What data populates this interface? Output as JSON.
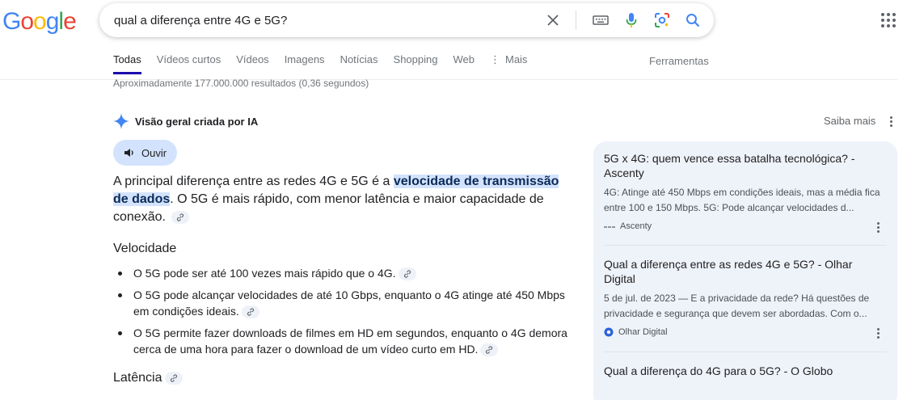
{
  "logo": {
    "letters": [
      "G",
      "o",
      "o",
      "g",
      "l",
      "e"
    ],
    "colors": [
      "#4285F4",
      "#EA4335",
      "#FBBC05",
      "#4285F4",
      "#34A853",
      "#EA4335"
    ]
  },
  "search": {
    "query": "qual a diferença entre 4G e 5G?"
  },
  "icons": {
    "clear": "close-icon",
    "keyboard": "keyboard-icon",
    "voice": "mic-icon",
    "lens": "lens-icon",
    "search": "search-icon",
    "apps": "apps-grid-icon"
  },
  "tabs": [
    {
      "label": "Todas",
      "active": true
    },
    {
      "label": "Vídeos curtos"
    },
    {
      "label": "Vídeos"
    },
    {
      "label": "Imagens"
    },
    {
      "label": "Notícias"
    },
    {
      "label": "Shopping"
    },
    {
      "label": "Web"
    },
    {
      "label": "Mais",
      "prefix": "⋮"
    }
  ],
  "tools_label": "Ferramentas",
  "result_stats": "Aproximadamente 177.000.000 resultados (0,36 segundos)",
  "ai_overview": {
    "title": "Visão geral criada por IA",
    "learn_more": "Saiba mais",
    "listen_label": "Ouvir",
    "intro": {
      "before": "A principal diferença entre as redes 4G e 5G é a ",
      "highlight": "velocidade de transmissão de dados",
      "after": ". O 5G é mais rápido, com menor latência e maior capacidade de conexão."
    },
    "sections": [
      {
        "title": "Velocidade",
        "bullets": [
          "O 5G pode ser até 100 vezes mais rápido que o 4G.",
          "O 5G pode alcançar velocidades de até 10 Gbps, enquanto o 4G atinge até 450 Mbps em condições ideais.",
          "O 5G permite fazer downloads de filmes em HD em segundos, enquanto o 4G demora cerca de uma hora para fazer o download de um vídeo curto em HD."
        ]
      },
      {
        "title": "Latência"
      }
    ]
  },
  "sources": [
    {
      "title": "5G x 4G: quem vence essa batalha tecnológica? - Ascenty",
      "snippet": "4G: Atinge até 450 Mbps em condições ideais, mas a média fica entre 100 e 150 Mbps. 5G: Pode alcançar velocidades d...",
      "site": "Ascenty"
    },
    {
      "title": "Qual a diferença entre as redes 4G e 5G? - Olhar Digital",
      "snippet": "5 de jul. de 2023 — E a privacidade da rede? Há questões de privacidade e segurança que devem ser abordadas. Com o...",
      "site": "Olhar Digital"
    },
    {
      "title": "Qual a diferença do 4G para o 5G? - O Globo"
    }
  ],
  "colors": {
    "accent_blue": "#1a0dab",
    "highlight_bg": "#d3e3fd",
    "sources_bg": "#eef2f9"
  }
}
